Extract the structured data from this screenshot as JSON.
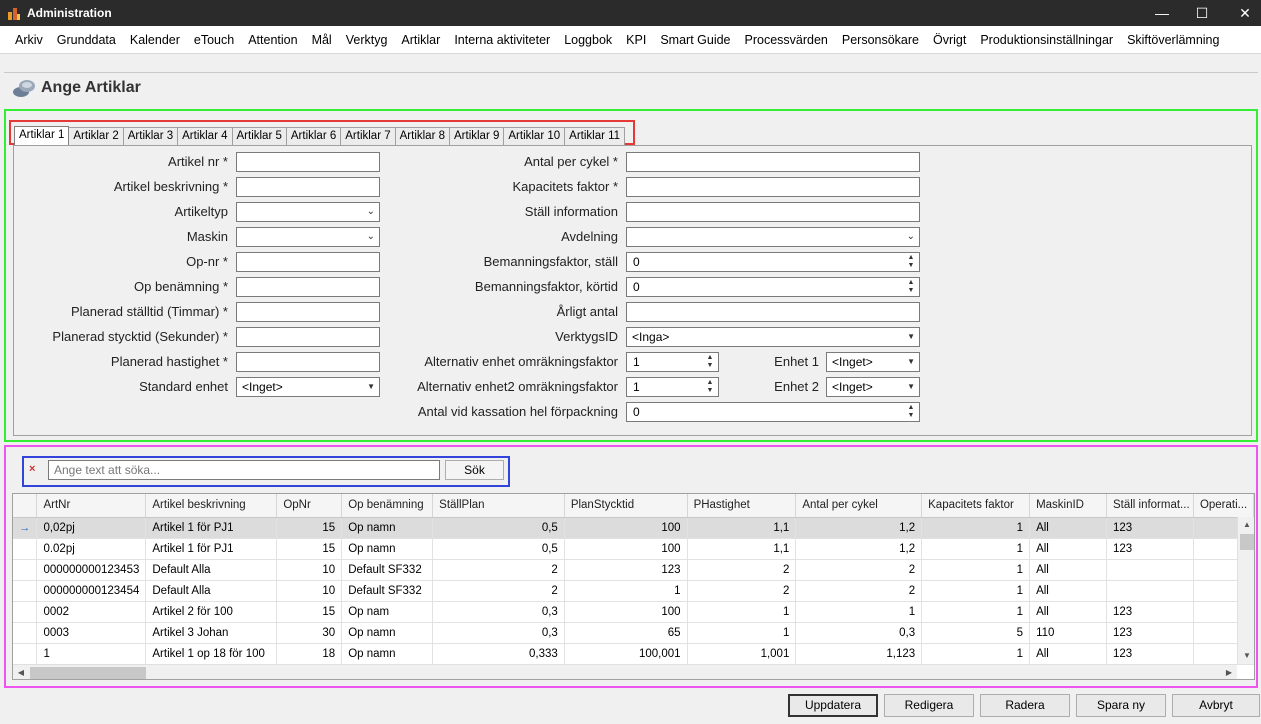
{
  "window": {
    "title": "Administration",
    "controls": {
      "minimize": "—",
      "maximize": "☐",
      "close": "✕"
    }
  },
  "menu": [
    "Arkiv",
    "Grunddata",
    "Kalender",
    "eTouch",
    "Attention",
    "Mål",
    "Verktyg",
    "Artiklar",
    "Interna aktiviteter",
    "Loggbok",
    "KPI",
    "Smart Guide",
    "Processvärden",
    "Personsökare",
    "Övrigt",
    "Produktionsinställningar",
    "Skiftöverlämning"
  ],
  "page": {
    "title": "Ange Artiklar"
  },
  "tabs": [
    "Artiklar 1",
    "Artiklar 2",
    "Artiklar 3",
    "Artiklar 4",
    "Artiklar 5",
    "Artiklar 6",
    "Artiklar 7",
    "Artiklar 8",
    "Artiklar 9",
    "Artiklar 10",
    "Artiklar 11"
  ],
  "active_tab": "Artiklar 1",
  "form": {
    "artikel_nr": {
      "label": "Artikel nr *",
      "value": ""
    },
    "artikel_beskrivning": {
      "label": "Artikel beskrivning *",
      "value": ""
    },
    "artikeltyp": {
      "label": "Artikeltyp",
      "value": ""
    },
    "maskin": {
      "label": "Maskin",
      "value": ""
    },
    "op_nr": {
      "label": "Op-nr *",
      "value": ""
    },
    "op_benamning": {
      "label": "Op benämning *",
      "value": ""
    },
    "planerad_stalltid": {
      "label": "Planerad ställtid (Timmar) *",
      "value": ""
    },
    "planerad_stycktid": {
      "label": "Planerad stycktid (Sekunder) *",
      "value": ""
    },
    "planerad_hastighet": {
      "label": "Planerad hastighet *",
      "value": ""
    },
    "standard_enhet": {
      "label": "Standard enhet",
      "value": "<Inget>"
    },
    "antal_per_cykel": {
      "label": "Antal per cykel *",
      "value": ""
    },
    "kapacitets_faktor": {
      "label": "Kapacitets faktor *",
      "value": ""
    },
    "stall_information": {
      "label": "Ställ information",
      "value": ""
    },
    "avdelning": {
      "label": "Avdelning",
      "value": ""
    },
    "bemanningsfaktor_stall": {
      "label": "Bemanningsfaktor, ställ",
      "value": "0"
    },
    "bemanningsfaktor_kortid": {
      "label": "Bemanningsfaktor, körtid",
      "value": "0"
    },
    "arligt_antal": {
      "label": "Årligt antal",
      "value": ""
    },
    "verktygs_id": {
      "label": "VerktygsID",
      "value": "<Inga>"
    },
    "alt_enhet_faktor": {
      "label": "Alternativ enhet omräkningsfaktor",
      "value": "1"
    },
    "alt_enhet2_faktor": {
      "label": "Alternativ enhet2 omräkningsfaktor",
      "value": "1"
    },
    "antal_kassation": {
      "label": "Antal vid kassation hel förpackning",
      "value": "0"
    },
    "enhet1": {
      "label": "Enhet 1",
      "value": "<Inget>"
    },
    "enhet2": {
      "label": "Enhet 2",
      "value": "<Inget>"
    }
  },
  "search": {
    "clear": "×",
    "placeholder": "Ange text att söka...",
    "button": "Sök"
  },
  "grid": {
    "columns": [
      "ArtNr",
      "Artikel beskrivning",
      "OpNr",
      "Op benämning",
      "StällPlan",
      "PlanStycktid",
      "PHastighet",
      "Antal per cykel",
      "Kapacitets faktor",
      "MaskinID",
      "Ställ informat...",
      "Operati..."
    ],
    "current_row_marker": "→",
    "rows": [
      [
        "0,02pj",
        "Artikel 1  för PJ1",
        "15",
        "Op namn",
        "0,5",
        "100",
        "1,1",
        "1,2",
        "1",
        "All",
        "123",
        ""
      ],
      [
        "0.02pj",
        "Artikel 1  för PJ1",
        "15",
        "Op namn",
        "0,5",
        "100",
        "1,1",
        "1,2",
        "1",
        "All",
        "123",
        ""
      ],
      [
        "000000000123453",
        "Default Alla",
        "10",
        "Default SF332",
        "2",
        "123",
        "2",
        "2",
        "1",
        "All",
        "",
        ""
      ],
      [
        "000000000123454",
        "Default Alla",
        "10",
        "Default SF332",
        "2",
        "1",
        "2",
        "2",
        "1",
        "All",
        "",
        ""
      ],
      [
        "0002",
        "Artikel 2  för 100",
        "15",
        "Op nam",
        "0,3",
        "100",
        "1",
        "1",
        "1",
        "All",
        "123",
        ""
      ],
      [
        "0003",
        "Artikel 3 Johan",
        "30",
        "Op namn",
        "0,3",
        "65",
        "1",
        "0,3",
        "5",
        "110",
        "123",
        ""
      ],
      [
        "1",
        "Artikel 1 op 18 för 100",
        "18",
        "Op namn",
        "0,333",
        "100,001",
        "1,001",
        "1,123",
        "1",
        "All",
        "123",
        ""
      ]
    ]
  },
  "footer": {
    "update": "Uppdatera",
    "edit": "Redigera",
    "delete": "Radera",
    "save_new": "Spara ny",
    "cancel": "Avbryt"
  }
}
